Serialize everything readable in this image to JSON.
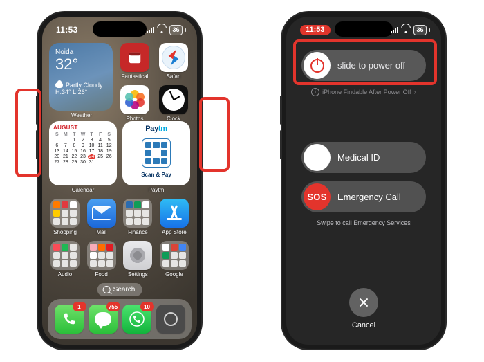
{
  "status_left": {
    "time": "11:53",
    "battery": "36"
  },
  "status_right": {
    "time": "11:53",
    "battery": "36"
  },
  "left_phone": {
    "weather": {
      "city": "Noida",
      "temp": "32°",
      "condition": "Partly Cloudy",
      "hilo": "H:34° L:26°",
      "label": "Weather"
    },
    "top_icons": {
      "fantastical": "Fantastical",
      "safari": "Safari",
      "photos": "Photos",
      "clock": "Clock"
    },
    "calendar": {
      "month": "AUGUST",
      "label": "Calendar",
      "days_header": [
        "S",
        "M",
        "T",
        "W",
        "T",
        "F",
        "S"
      ],
      "leading_blanks": 2,
      "days": 31,
      "today": 24
    },
    "paytm": {
      "logo_a": "Pay",
      "logo_b": "tm",
      "scan": "Scan & Pay",
      "label": "Paytm"
    },
    "row1": {
      "shopping": "Shopping",
      "mail": "Mail",
      "finance": "Finance",
      "appstore": "App Store"
    },
    "row2": {
      "audio": "Audio",
      "food": "Food",
      "settings": "Settings",
      "google": "Google"
    },
    "search": "Search",
    "dock_badges": {
      "phone": "1",
      "messages": "755",
      "whatsapp": "10"
    }
  },
  "right_phone": {
    "slide": "slide to power off",
    "findable": "iPhone Findable After Power Off",
    "medical": "Medical ID",
    "medical_symbol": "✱",
    "sos_label": "SOS",
    "emergency": "Emergency Call",
    "swipe_note": "Swipe to call Emergency Services",
    "cancel": "Cancel"
  }
}
